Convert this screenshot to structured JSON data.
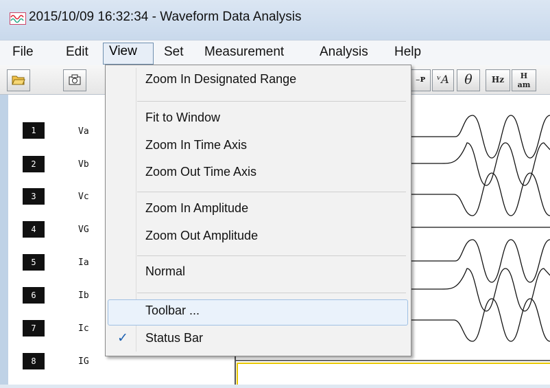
{
  "window": {
    "title": "2015/10/09 16:32:34  - Waveform Data Analysis"
  },
  "menubar": {
    "items": [
      "File",
      "Edit",
      "View",
      "Set",
      "Measurement",
      "Analysis",
      "Help"
    ]
  },
  "toolbar": {
    "visible_buttons": [
      "open",
      "camera",
      "Z-P",
      "VA",
      "θ",
      "Hz",
      "H am"
    ]
  },
  "channels": [
    {
      "num": "1",
      "name": "Va"
    },
    {
      "num": "2",
      "name": "Vb"
    },
    {
      "num": "3",
      "name": "Vc"
    },
    {
      "num": "4",
      "name": "VG"
    },
    {
      "num": "5",
      "name": "Ia"
    },
    {
      "num": "6",
      "name": "Ib"
    },
    {
      "num": "7",
      "name": "Ic"
    },
    {
      "num": "8",
      "name": "IG"
    }
  ],
  "view_menu": {
    "zoom_designated": "Zoom In Designated Range",
    "fit_window": "Fit to Window",
    "zoom_in_time": "Zoom In Time Axis",
    "zoom_out_time": "Zoom Out Time Axis",
    "zoom_in_amp": "Zoom In Amplitude",
    "zoom_out_amp": "Zoom Out Amplitude",
    "normal": "Normal",
    "toolbar": "Toolbar ...",
    "status_bar": "Status Bar",
    "status_bar_checked": true,
    "highlighted_item": "Toolbar ..."
  },
  "colors": {
    "highlight": "#eaf2fb",
    "check": "#1b5fb0",
    "cursor_line": "#e8c700"
  }
}
